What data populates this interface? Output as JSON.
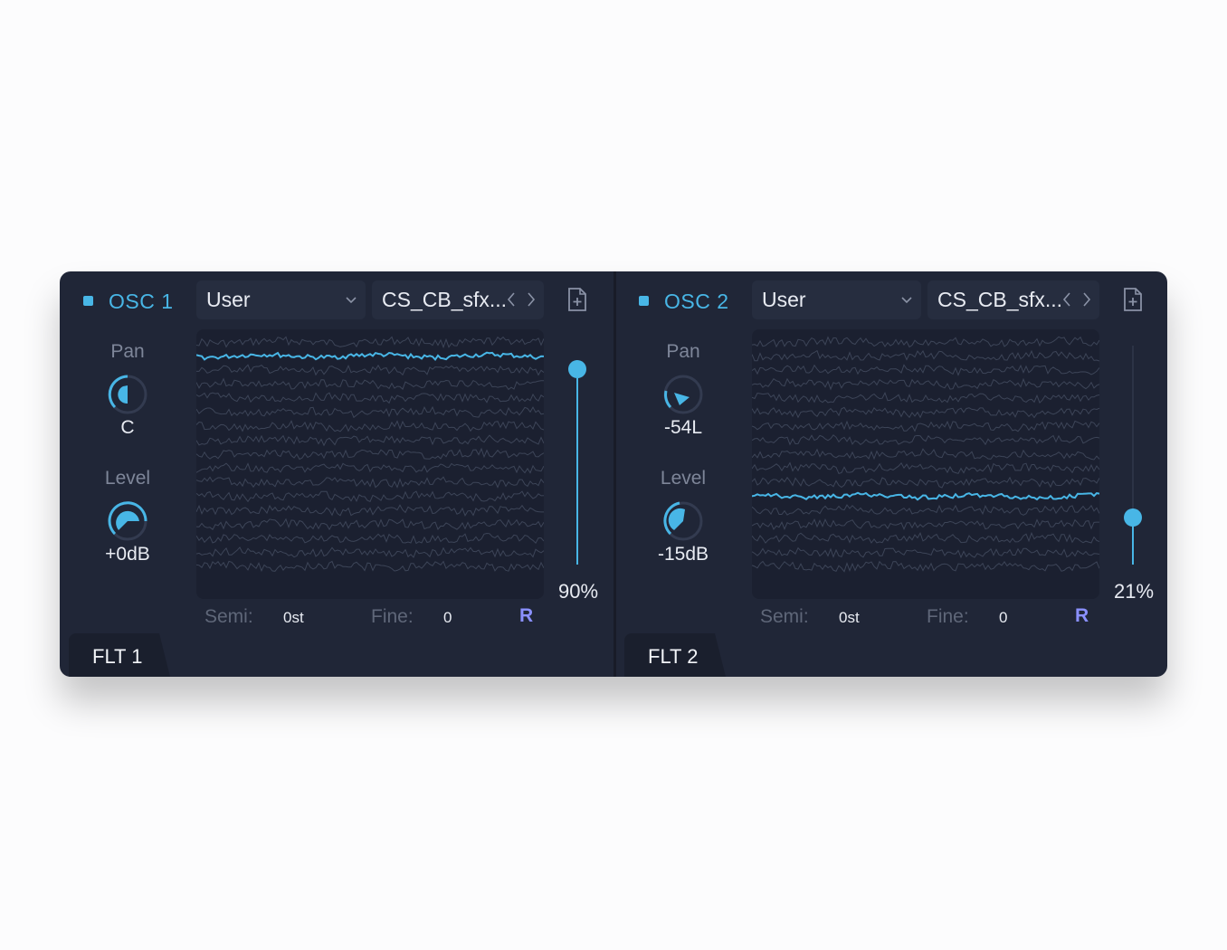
{
  "colors": {
    "accent": "#48b6e6",
    "panel": "#202637",
    "wave_bg": "#1b2030",
    "r_button": "#8a90ff"
  },
  "icons": {
    "dropdown": "chevron-down-icon",
    "prev": "chevron-left-icon",
    "next": "chevron-right-icon",
    "file": "file-plus-icon"
  },
  "osc1": {
    "title": "OSC 1",
    "type": "User",
    "sample": "CS_CB_sfx...",
    "pan_label": "Pan",
    "pan_value": "C",
    "level_label": "Level",
    "level_value": "+0dB",
    "position_pct": "90%",
    "position_fraction": 0.9,
    "semi_label": "Semi:",
    "semi_value": "0st",
    "fine_label": "Fine:",
    "fine_value": "0",
    "r_label": "R",
    "filter_tab": "FLT 1",
    "active_wave_index": 1
  },
  "osc2": {
    "title": "OSC 2",
    "type": "User",
    "sample": "CS_CB_sfx...",
    "pan_label": "Pan",
    "pan_value": "-54L",
    "level_label": "Level",
    "level_value": "-15dB",
    "position_pct": "21%",
    "position_fraction": 0.21,
    "semi_label": "Semi:",
    "semi_value": "0st",
    "fine_label": "Fine:",
    "fine_value": "0",
    "r_label": "R",
    "filter_tab": "FLT 2",
    "active_wave_index": 11
  }
}
